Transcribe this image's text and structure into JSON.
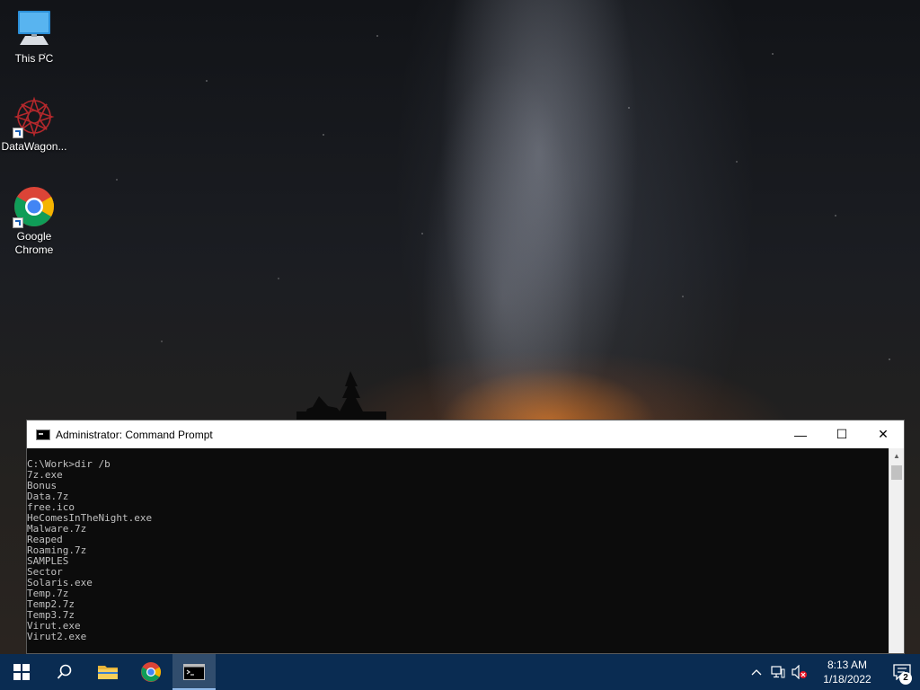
{
  "desktop": {
    "icons": [
      {
        "label": "This PC",
        "icon": "computer-icon"
      },
      {
        "label": "DataWagon...",
        "icon": "datawagon-icon"
      },
      {
        "label": "Google\nChrome",
        "icon": "chrome-icon"
      }
    ]
  },
  "cmd": {
    "title": "Administrator: Command Prompt",
    "lines": [
      "C:\\Work>dir /b",
      "7z.exe",
      "Bonus",
      "Data.7z",
      "free.ico",
      "HeComesInTheNight.exe",
      "Malware.7z",
      "Reaped",
      "Roaming.7z",
      "SAMPLES",
      "Sector",
      "Solaris.exe",
      "Temp.7z",
      "Temp2.7z",
      "Temp3.7z",
      "Virut.exe",
      "Virut2.exe"
    ],
    "minimize_glyph": "—",
    "maximize_glyph": "☐",
    "close_glyph": "✕"
  },
  "taskbar": {
    "time": "8:13 AM",
    "date": "1/18/2022",
    "notification_count": "2",
    "accent": "#0a2c52"
  }
}
